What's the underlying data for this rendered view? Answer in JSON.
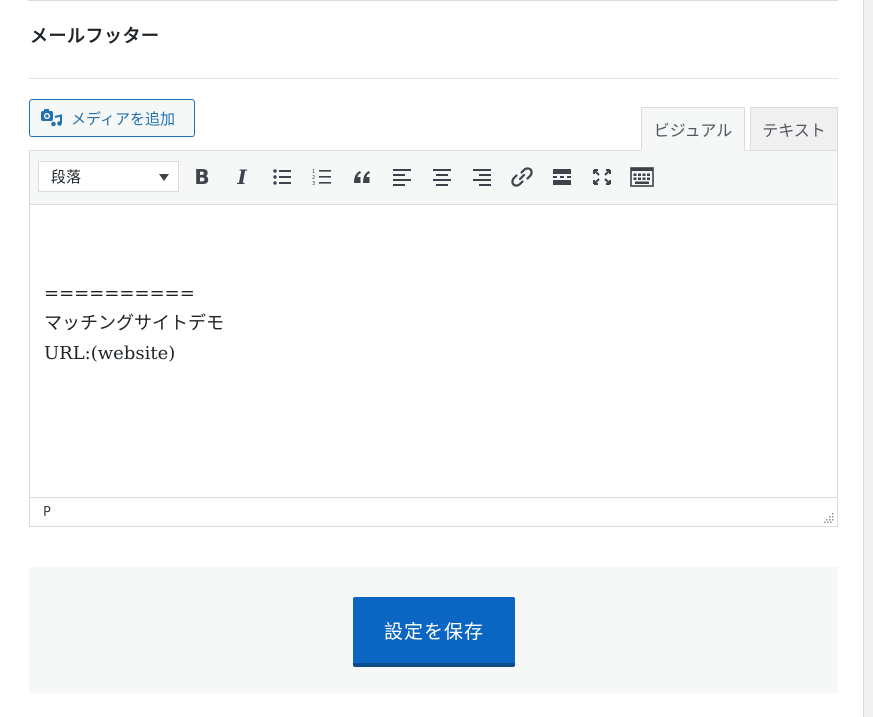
{
  "section": {
    "title": "メールフッター"
  },
  "media": {
    "add_label": "メディアを追加",
    "icon": "media-camera-music-icon"
  },
  "tabs": {
    "visual": "ビジュアル",
    "text": "テキスト",
    "active": "visual"
  },
  "toolbar": {
    "format_value": "段落",
    "buttons": [
      {
        "name": "bold",
        "glyph": "B"
      },
      {
        "name": "italic",
        "glyph": "I"
      },
      {
        "name": "bulleted-list"
      },
      {
        "name": "numbered-list"
      },
      {
        "name": "blockquote"
      },
      {
        "name": "align-left"
      },
      {
        "name": "align-center"
      },
      {
        "name": "align-right"
      },
      {
        "name": "insert-link"
      },
      {
        "name": "read-more"
      },
      {
        "name": "fullscreen"
      },
      {
        "name": "toolbar-toggle"
      }
    ]
  },
  "content": {
    "lines": [
      "==========",
      "マッチングサイトデモ",
      "URL:(website)"
    ]
  },
  "statusbar": {
    "path": "P"
  },
  "save": {
    "label": "設定を保存"
  },
  "colors": {
    "accent": "#2271b1",
    "save_button": "#0a66c2"
  }
}
